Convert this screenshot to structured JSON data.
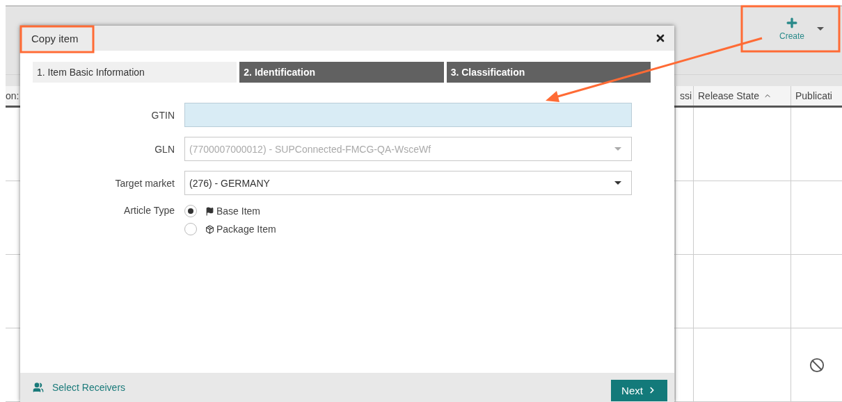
{
  "toolbar": {
    "create_button": {
      "label": "Create"
    }
  },
  "table": {
    "columns": [
      {
        "label": "on:"
      },
      {
        "label": "ssi"
      },
      {
        "label": "Release State",
        "sorted_ascending": true
      },
      {
        "label": "Publicati",
        "sorted_ascending": false
      }
    ],
    "rows": [
      {
        "blocked": false
      },
      {
        "blocked": false
      },
      {
        "blocked": false
      },
      {
        "blocked": true
      }
    ]
  },
  "dialog": {
    "title": "Copy item",
    "tabs": [
      {
        "label": "1. Item Basic Information",
        "selected": true
      },
      {
        "label": "2. Identification",
        "selected": false
      },
      {
        "label": "3. Classification",
        "selected": false
      }
    ],
    "fields": [
      {
        "kind": "input",
        "label": "GTIN",
        "highlighted": true,
        "disabled": false
      },
      {
        "kind": "select",
        "label": "GLN",
        "value": "(7700007000012) - SUPConnected-FMCG-QA-WsceWf",
        "highlighted": false,
        "disabled": true
      },
      {
        "kind": "select",
        "label": "Target market",
        "value": "(276) - GERMANY",
        "highlighted": false,
        "disabled": false
      }
    ],
    "article_type": {
      "label": "Article Type",
      "options": [
        {
          "kind": "flag",
          "label": "Base Item",
          "selected": true
        },
        {
          "kind": "package",
          "label": "Package Item",
          "selected": false
        }
      ]
    },
    "footer": {
      "link": "Select Receivers",
      "next_button": "Next"
    }
  }
}
